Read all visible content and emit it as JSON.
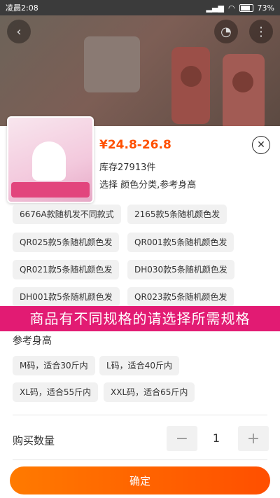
{
  "status_bar": {
    "time": "凌晨2:08",
    "battery": "73%"
  },
  "product": {
    "price": "¥24.8-26.8",
    "stock": "库存27913件",
    "select_hint": "选择 颜色分类,参考身高"
  },
  "color_options": [
    "6676A款随机发不同款式",
    "2165款5条随机颜色发",
    "QR025款5条随机颜色发",
    "QR001款5条随机颜色发",
    "QR021款5条随机颜色发",
    "DH030款5条随机颜色发",
    "DH001款5条随机颜色发",
    "QR023款5条随机颜色发"
  ],
  "banner": "商品有不同规格的请选择所需规格",
  "size_section": {
    "title": "参考身高",
    "options": [
      "M码，适合30斤内",
      "L码，适合40斤内",
      "XL码，适合55斤内",
      "XXL码，适合65斤内"
    ]
  },
  "quantity": {
    "label": "购买数量",
    "value": "1",
    "minus": "−",
    "plus": "+"
  },
  "confirm_label": "确定",
  "icons": {
    "back": "chevron-left-icon",
    "close": "close-circle-icon",
    "more": "more-icon"
  },
  "colors": {
    "accent": "#ff5000",
    "banner": "#e21b73",
    "chip_bg": "#f1f1f1"
  }
}
